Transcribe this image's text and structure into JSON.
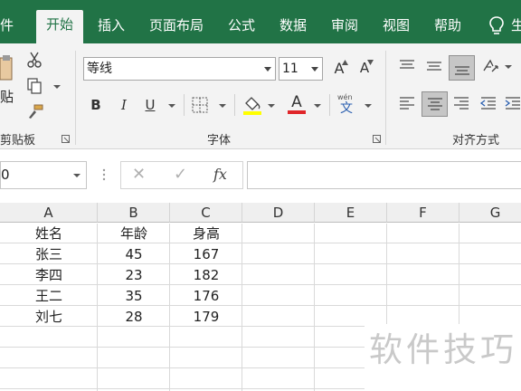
{
  "ribbon_tabs": {
    "file_partial": "件",
    "home": "开始",
    "insert": "插入",
    "page_layout": "页面布局",
    "formulas": "公式",
    "data": "数据",
    "review": "审阅",
    "view": "视图",
    "help": "帮助",
    "tell_me_partial": "生"
  },
  "clipboard": {
    "paste_partial": "贴",
    "group_label": "剪贴板"
  },
  "font": {
    "font_name": "等线",
    "font_size": "11",
    "increase_size": "A",
    "decrease_size": "A",
    "bold": "B",
    "italic": "I",
    "underline": "U",
    "font_color": "A",
    "phonetic_top": "wén",
    "phonetic_char": "文",
    "group_label": "字体",
    "highlight_color": "#ffff00",
    "font_color_value": "#e0262a"
  },
  "alignment": {
    "group_label": "对齐方式"
  },
  "formula_bar": {
    "name_box_value": "0",
    "cancel": "✕",
    "enter": "✓",
    "fx": "fx",
    "formula_value": ""
  },
  "sheet": {
    "columns": [
      "A",
      "B",
      "C",
      "D",
      "E",
      "F",
      "G"
    ],
    "rows": [
      [
        "姓名",
        "年龄",
        "身高"
      ],
      [
        "张三",
        "45",
        "167"
      ],
      [
        "李四",
        "23",
        "182"
      ],
      [
        "王二",
        "35",
        "176"
      ],
      [
        "刘七",
        "28",
        "179"
      ]
    ]
  },
  "watermark": "软件技巧",
  "colors": {
    "ribbon_green": "#217346",
    "ribbon_bg": "#f3f3f3"
  }
}
